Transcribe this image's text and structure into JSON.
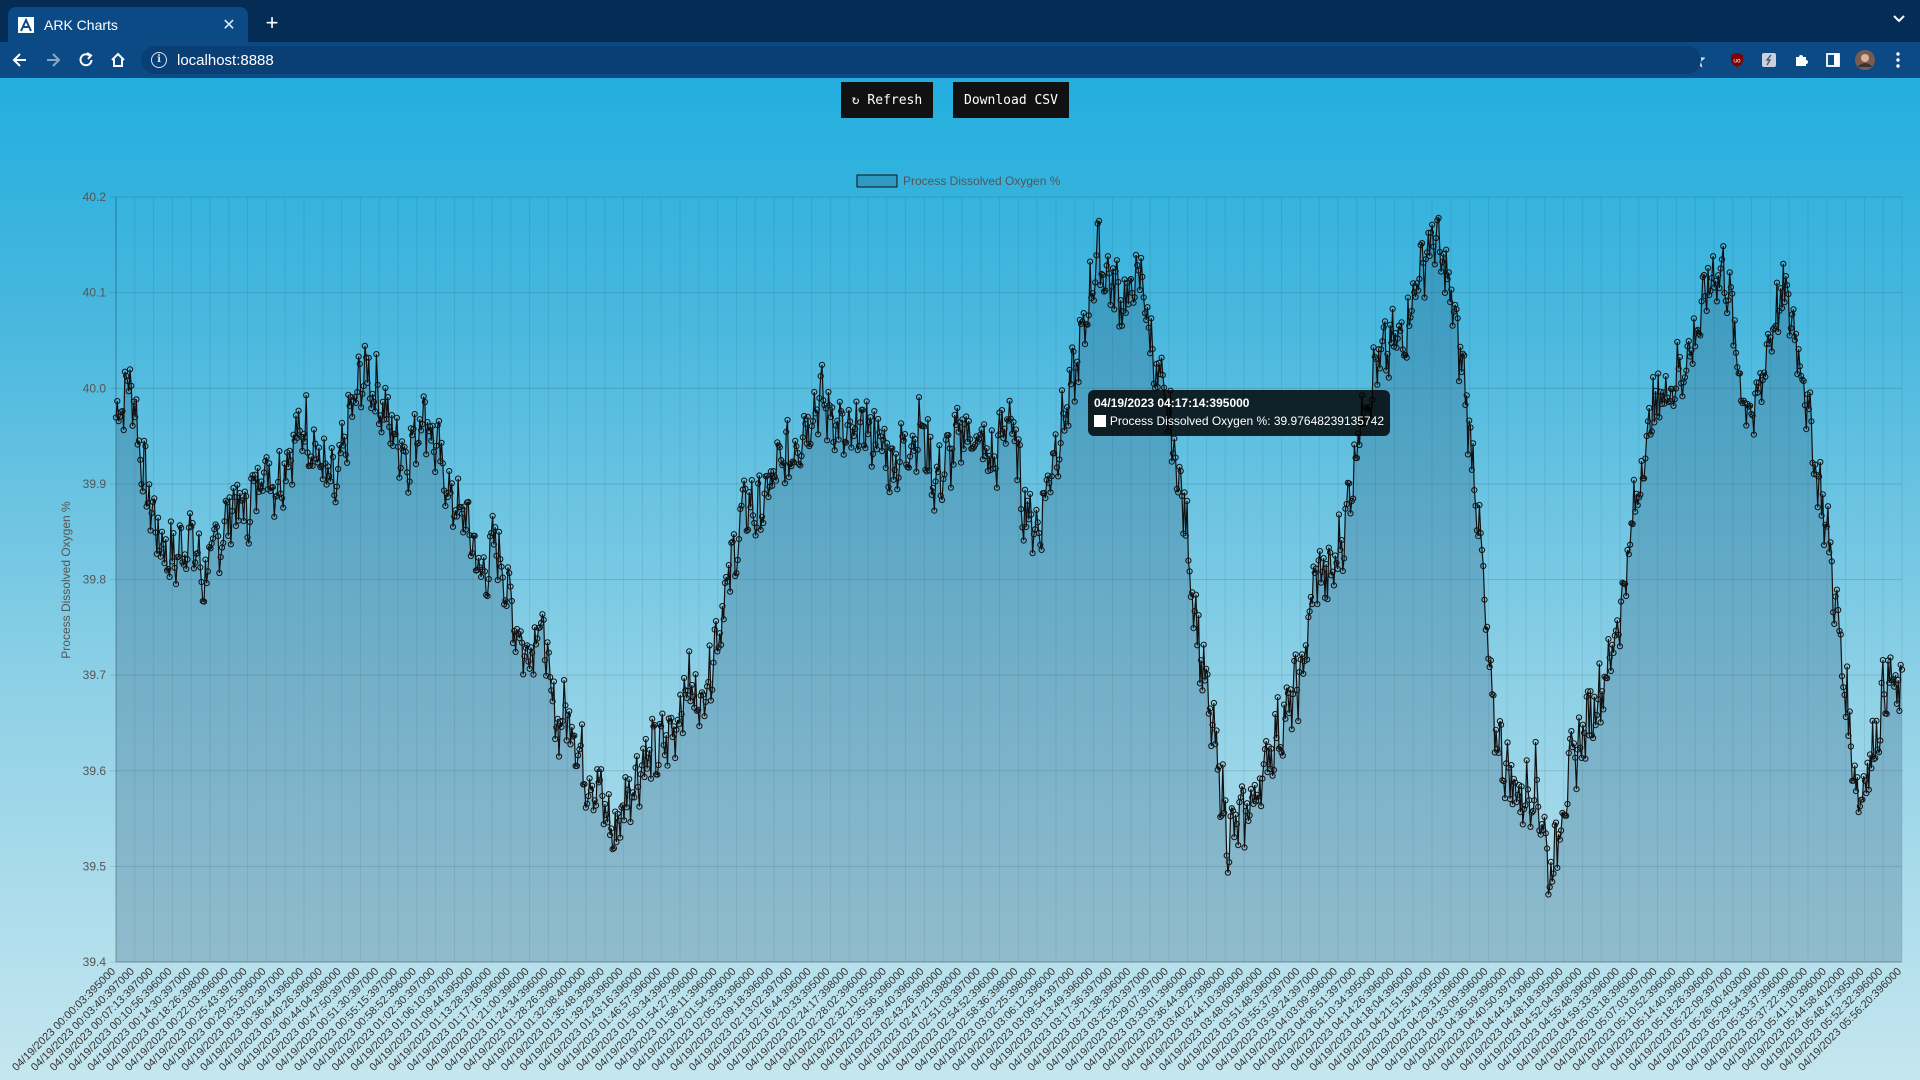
{
  "browser": {
    "tab_title": "ARK Charts",
    "new_tab_symbol": "+",
    "close_symbol": "✕",
    "url": "localhost:8888"
  },
  "toolbar": {
    "refresh_label": "↻ Refresh",
    "download_label": "Download CSV"
  },
  "colors": {
    "tab_bar": "#042c54",
    "toolbar": "#0c4a86",
    "series_stroke": "#111111",
    "series_fill": "rgba(40,80,110,0.25)"
  },
  "icons": [
    "back-icon",
    "forward-icon",
    "reload-icon",
    "home-icon",
    "info-icon",
    "share-icon",
    "star-icon",
    "ublock-icon",
    "extension-icon",
    "puzzle-icon",
    "sidepanel-icon",
    "profile-avatar",
    "menu-icon"
  ],
  "tooltip": {
    "title": "04/19/2023 04:17:14:395000",
    "label": "Process Dissolved Oxygen %: 39.97648239135742"
  },
  "chart_data": {
    "type": "area",
    "title": "",
    "legend": {
      "label": "Process Dissolved Oxygen %",
      "position": "top"
    },
    "ylabel": "Process Dissolved Oxygen %",
    "xlabel": "",
    "ylim": [
      39.4,
      40.2
    ],
    "yticks": [
      "39.4",
      "39.5",
      "39.6",
      "39.7",
      "39.8",
      "39.9",
      "40.0",
      "40.1",
      "40.2"
    ],
    "grid": true,
    "x_start": "04/19/2023 00:00:03:395000",
    "x_end": "04/19/2023 06:00:00:395000",
    "tick_labels": [
      "04/19/2023 00:00:03:395000",
      "04/19/2023 00:03:40:397000",
      "04/19/2023 00:07:13:397000",
      "04/19/2023 00:10:56:396000",
      "04/19/2023 00:14:30:397000",
      "04/19/2023 00:18:26:398000",
      "04/19/2023 00:22:03:396000",
      "04/19/2023 00:25:43:397000",
      "04/19/2023 00:29:25:396000",
      "04/19/2023 00:33:02:397000",
      "04/19/2023 00:36:44:396000",
      "04/19/2023 00:40:26:396000",
      "04/19/2023 00:44:04:398000",
      "04/19/2023 00:47:50:397000",
      "04/19/2023 00:51:30:397000",
      "04/19/2023 00:55:15:397000",
      "04/19/2023 00:58:52:396000",
      "04/19/2023 01:02:30:397000",
      "04/19/2023 01:06:10:397000",
      "04/19/2023 01:09:44:395000",
      "04/19/2023 01:13:28:396000",
      "04/19/2023 01:17:16:396000",
      "04/19/2023 01:21:00:396000",
      "04/19/2023 01:24:34:396000",
      "04/19/2023 01:28:26:396000",
      "04/19/2023 01:32:08:400000",
      "04/19/2023 01:35:48:396000",
      "04/19/2023 01:39:29:396000",
      "04/19/2023 01:43:16:396000",
      "04/19/2023 01:46:57:396000",
      "04/19/2023 01:50:34:396000",
      "04/19/2023 01:54:27:396000",
      "04/19/2023 01:58:11:396000",
      "04/19/2023 02:01:54:396000",
      "04/19/2023 02:05:33:396000",
      "04/19/2023 02:09:18:396000",
      "04/19/2023 02:13:02:397000",
      "04/19/2023 02:16:44:396000",
      "04/19/2023 02:20:33:395000",
      "04/19/2023 02:24:17:398000",
      "04/19/2023 02:28:02:396000",
      "04/19/2023 02:32:10:395000",
      "04/19/2023 02:35:56:396000",
      "04/19/2023 02:39:40:396000",
      "04/19/2023 02:43:26:396000",
      "04/19/2023 02:47:21:398000",
      "04/19/2023 02:51:03:397000",
      "04/19/2023 02:54:52:396000",
      "04/19/2023 02:58:36:398000",
      "04/19/2023 03:02:25:398000",
      "04/19/2023 03:06:12:396000",
      "04/19/2023 03:09:54:397000",
      "04/19/2023 03:13:49:396000",
      "04/19/2023 03:17:36:397000",
      "04/19/2023 03:21:38:396000",
      "04/19/2023 03:25:20:397000",
      "04/19/2023 03:29:07:397000",
      "04/19/2023 03:33:01:396000",
      "04/19/2023 03:36:44:396000",
      "04/19/2023 03:40:27:398000",
      "04/19/2023 03:44:10:396000",
      "04/19/2023 03:48:00:396000",
      "04/19/2023 03:51:48:396000",
      "04/19/2023 03:55:37:397000",
      "04/19/2023 03:59:24:397000",
      "04/19/2023 04:03:09:396000",
      "04/19/2023 04:06:51:397000",
      "04/19/2023 04:10:34:395000",
      "04/19/2023 04:14:26:396000",
      "04/19/2023 04:18:04:396000",
      "04/19/2023 04:21:51:396000",
      "04/19/2023 04:25:41:395000",
      "04/19/2023 04:29:31:396000",
      "04/19/2023 04:33:09:396000",
      "04/19/2023 04:36:59:396000",
      "04/19/2023 04:40:50:397000",
      "04/19/2023 04:44:34:396000",
      "04/19/2023 04:48:18:395000",
      "04/19/2023 04:52:04:396000",
      "04/19/2023 04:55:48:396000",
      "04/19/2023 04:59:33:396000",
      "04/19/2023 05:03:18:396000",
      "04/19/2023 05:07:03:397000",
      "04/19/2023 05:10:52:396000",
      "04/19/2023 05:14:40:396000",
      "04/19/2023 05:18:26:396000",
      "04/19/2023 05:22:09:397000",
      "04/19/2023 05:26:00:403000",
      "04/19/2023 05:29:54:396000",
      "04/19/2023 05:33:37:396000",
      "04/19/2023 05:37:22:398000",
      "04/19/2023 05:41:10:396000",
      "04/19/2023 05:44:58:402000",
      "04/19/2023 05:48:47:395000",
      "04/19/2023 05:52:32:396000",
      "04/19/2023 05:56:20:396000"
    ],
    "series": [
      {
        "name": "Process Dissolved Oxygen %",
        "anchors": [
          39.97,
          40.01,
          39.9,
          39.84,
          39.82,
          39.85,
          39.8,
          39.84,
          39.88,
          39.87,
          39.92,
          39.9,
          39.94,
          39.96,
          39.92,
          39.89,
          39.97,
          40.02,
          39.99,
          39.95,
          39.93,
          39.98,
          39.93,
          39.88,
          39.86,
          39.8,
          39.84,
          39.77,
          39.72,
          39.76,
          39.65,
          39.66,
          39.6,
          39.58,
          39.53,
          39.58,
          39.61,
          39.62,
          39.64,
          39.69,
          39.67,
          39.74,
          39.81,
          39.88,
          39.87,
          39.91,
          39.93,
          39.96,
          39.99,
          39.97,
          39.94,
          39.96,
          39.95,
          39.92,
          39.94,
          39.96,
          39.9,
          39.93,
          39.96,
          39.94,
          39.92,
          39.98,
          39.88,
          39.85,
          39.93,
          39.98,
          40.05,
          40.14,
          40.11,
          40.09,
          40.12,
          40.02,
          39.96,
          39.87,
          39.73,
          39.63,
          39.53,
          39.55,
          39.58,
          39.63,
          39.66,
          39.7,
          39.81,
          39.8,
          39.86,
          39.97,
          40.02,
          40.04,
          40.06,
          40.12,
          40.16,
          40.11,
          40.02,
          39.88,
          39.66,
          39.6,
          39.57,
          39.59,
          39.49,
          39.58,
          39.63,
          39.67,
          39.71,
          39.79,
          39.9,
          39.98,
          40.0,
          40.02,
          40.06,
          40.12,
          40.12,
          40.0,
          39.97,
          40.06,
          40.1,
          40.04,
          39.93,
          39.84,
          39.7,
          39.57,
          39.62,
          39.7,
          39.67
        ]
      }
    ]
  }
}
